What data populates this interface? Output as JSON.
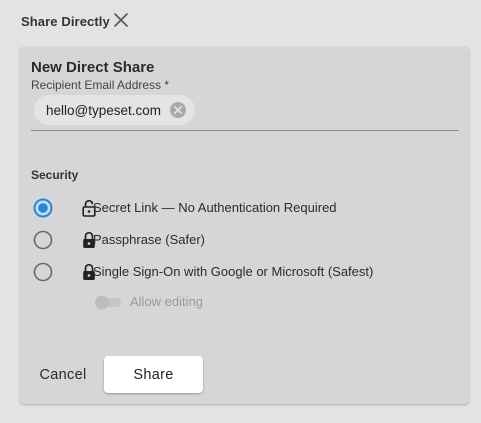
{
  "dialog": {
    "title": "Share Directly",
    "close_icon": "close-icon"
  },
  "form": {
    "heading": "New Direct Share",
    "recipient_label": "Recipient Email Address *",
    "recipients": [
      {
        "email": "hello@typeset.com",
        "remove_icon": "cancel-circle-icon"
      }
    ],
    "security_label": "Security",
    "security_options": [
      {
        "label": "Secret Link — No Authentication Required",
        "selected": true,
        "icon": "unlocked-icon"
      },
      {
        "label": "Passphrase (Safer)",
        "selected": false,
        "icon": "lock-icon"
      },
      {
        "label": "Single Sign-On with Google or Microsoft (Safest)",
        "selected": false,
        "icon": "lock-icon"
      }
    ],
    "allow_editing": {
      "label": "Allow editing",
      "enabled": false,
      "disabled": true
    }
  },
  "actions": {
    "cancel_label": "Cancel",
    "share_label": "Share"
  },
  "colors": {
    "accent": "#1e88e5",
    "background": "#e3e3e5",
    "panel": "#d6d6d8"
  }
}
